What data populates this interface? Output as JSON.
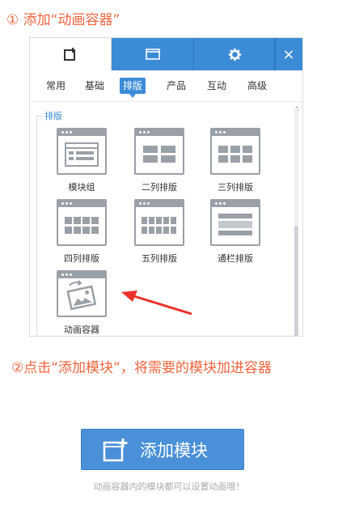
{
  "step1": "① 添加“动画容器”",
  "top_tabs": {
    "close_label": "×"
  },
  "sub_tabs": [
    "常用",
    "基础",
    "排版",
    "产品",
    "互动",
    "高级"
  ],
  "section_title": "排版",
  "tiles": [
    {
      "label": "模块组",
      "icon": "module-group-icon"
    },
    {
      "label": "二列排版",
      "icon": "two-column-icon"
    },
    {
      "label": "三列排版",
      "icon": "three-column-icon"
    },
    {
      "label": "四列排版",
      "icon": "four-column-icon"
    },
    {
      "label": "五列排版",
      "icon": "five-column-icon"
    },
    {
      "label": "通栏排版",
      "icon": "banner-layout-icon"
    },
    {
      "label": "动画容器",
      "icon": "animation-container-icon"
    }
  ],
  "step2": "②点击“添加模块”，将需要的模块加进容器",
  "add_button_label": "添加模块",
  "hint": "动画容器内的模块都可以设置动画哦！",
  "colors": {
    "accent": "#3c8bd6",
    "annotation": "#f0643c",
    "arrow": "#e8322a"
  }
}
